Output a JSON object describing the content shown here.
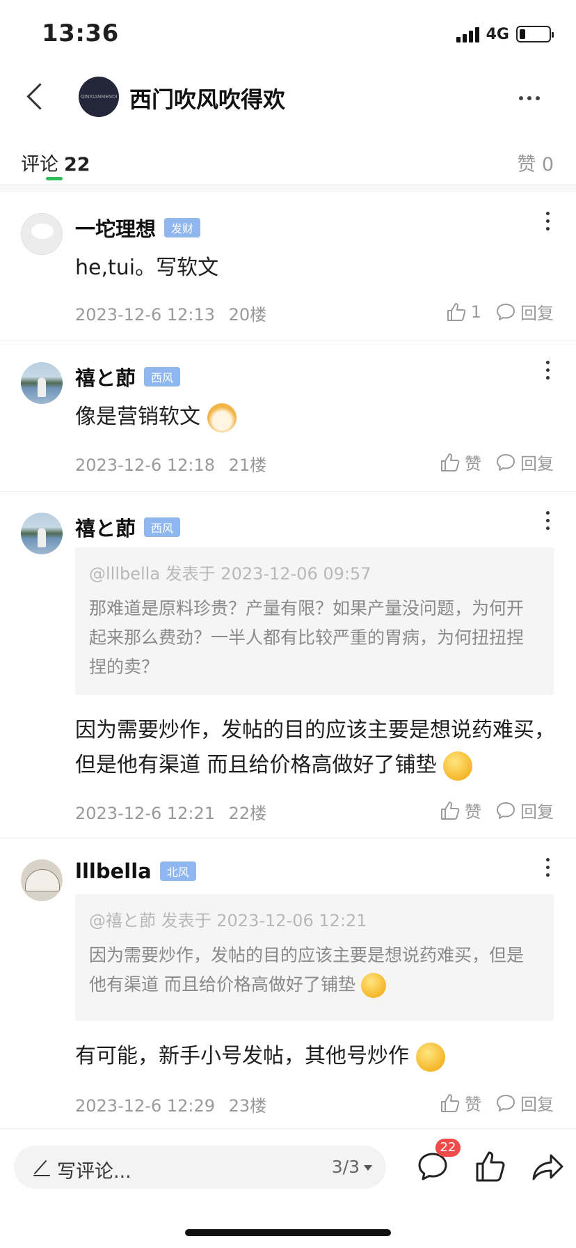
{
  "status": {
    "time": "13:36",
    "network": "4G"
  },
  "header": {
    "title": "西门吹风吹得欢",
    "logo_text": "QINXIANMENDI"
  },
  "tabs": {
    "comments_label": "评论",
    "comments_count": "22",
    "likes_label": "赞 0"
  },
  "comments": [
    {
      "user": "一坨理想",
      "badge": "发财",
      "text": "he,tui。写软文",
      "date": "2023-12-6 12:13",
      "floor": "20楼",
      "like": "1",
      "reply": "回复"
    },
    {
      "user": "禧と莭",
      "badge": "西风",
      "text": "像是营销软文",
      "date": "2023-12-6 12:18",
      "floor": "21楼",
      "like": "赞",
      "reply": "回复"
    },
    {
      "user": "禧と莭",
      "badge": "西风",
      "quote_head": "@lllbella 发表于 2023-12-06 09:57",
      "quote_body": "那难道是原料珍贵？产量有限？如果产量没问题，为何开起来那么费劲？一半人都有比较严重的胃病，为何扭扭捏捏的卖？",
      "text": "因为需要炒作，发帖的目的应该主要是想说药难买，但是他有渠道  而且给价格高做好了铺垫",
      "date": "2023-12-6 12:21",
      "floor": "22楼",
      "like": "赞",
      "reply": "回复"
    },
    {
      "user": "lllbella",
      "badge": "北风",
      "quote_head": "@禧と莭 发表于 2023-12-06 12:21",
      "quote_body": "因为需要炒作，发帖的目的应该主要是想说药难买，但是他有渠道  而且给价格高做好了铺垫",
      "text": "有可能，新手小号发帖，其他号炒作",
      "date": "2023-12-6 12:29",
      "floor": "23楼",
      "like": "赞",
      "reply": "回复"
    }
  ],
  "bottom": {
    "placeholder": "写评论...",
    "page": "3/3",
    "comment_count": "22"
  },
  "colors": {
    "accent": "#2ebd5a",
    "badge": "#8fb6ee",
    "count_badge": "#f04a4a"
  }
}
